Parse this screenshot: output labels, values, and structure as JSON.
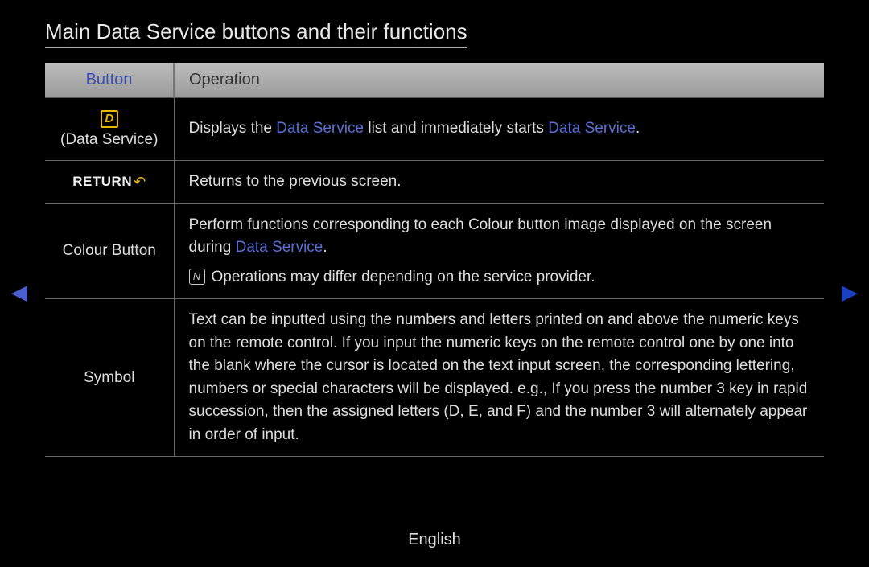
{
  "title": "Main Data Service buttons and their functions",
  "headers": {
    "button": "Button",
    "operation": "Operation"
  },
  "rows": {
    "dataService": {
      "label": "(Data Service)",
      "op_pre": "Displays the ",
      "op_link1": "Data Service",
      "op_mid": " list and immediately starts ",
      "op_link2": "Data Service",
      "op_post": "."
    },
    "return": {
      "label": "RETURN",
      "op": "Returns to the previous screen."
    },
    "colour": {
      "label": "Colour Button",
      "op_pre": "Perform functions corresponding to each Colour button image displayed on the screen during ",
      "op_link": "Data Service",
      "op_post": ".",
      "note": "Operations may differ depending on the service provider."
    },
    "symbol": {
      "label": "Symbol",
      "op": "Text can be inputted using the numbers and letters printed on and above the numeric keys on the remote control. If you input the numeric keys on the remote control one by one into the blank where the cursor is located on the text input screen, the corresponding lettering, numbers or special characters will be displayed. e.g., If you press the number 3 key in rapid succession, then the assigned letters (D, E, and F) and the number 3 will alternately appear in order of input."
    }
  },
  "footer": {
    "language": "English"
  },
  "icons": {
    "d_glyph": "D",
    "note_glyph": "N"
  }
}
